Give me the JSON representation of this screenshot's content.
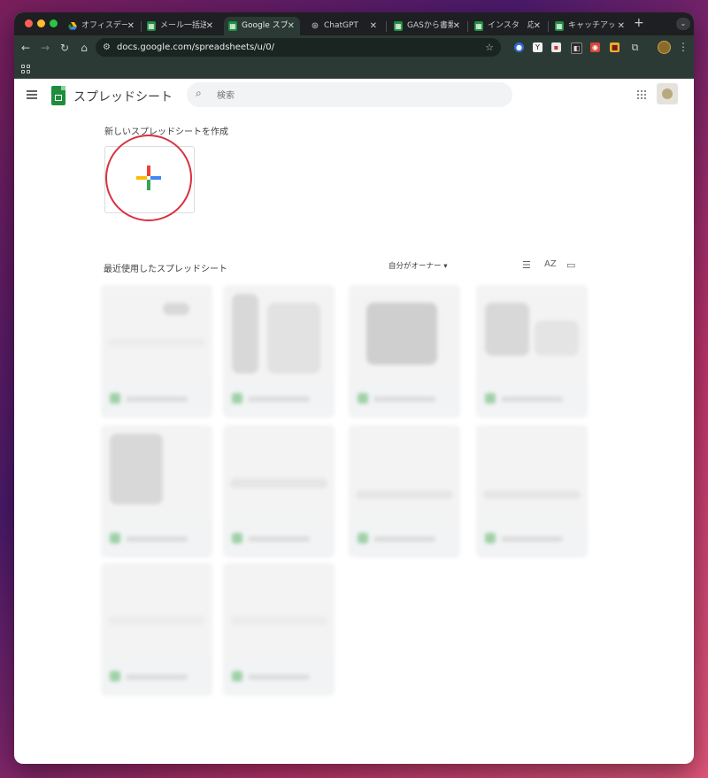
{
  "browser": {
    "tabs": [
      {
        "title": "オフィスデータ",
        "icon": "drive-icon",
        "active": false
      },
      {
        "title": "メール一括送信",
        "icon": "sheets-icon",
        "active": false
      },
      {
        "title": "Google スプレ",
        "icon": "sheets-icon",
        "active": true
      },
      {
        "title": "ChatGPT",
        "icon": "chatgpt-icon",
        "active": false
      },
      {
        "title": "GASから書類作",
        "icon": "sheets-icon",
        "active": false
      },
      {
        "title": "インスタ　応援",
        "icon": "sheets-icon",
        "active": false
      },
      {
        "title": "キャッチアップ",
        "icon": "sheets-icon",
        "active": false
      }
    ],
    "new_tab_label": "+",
    "url": "docs.google.com/spreadsheets/u/0/"
  },
  "header": {
    "app_title": "スプレッドシート",
    "search_placeholder": "検索"
  },
  "templates": {
    "section_label": "新しいスプレッドシートを作成"
  },
  "recent": {
    "section_label": "最近使用したスプレッドシート",
    "owner_filter": "自分がオーナー ▾"
  },
  "colors": {
    "plus_red": "#ea4335",
    "plus_blue": "#4285f4",
    "plus_yellow": "#fbbc04",
    "plus_green": "#34a853",
    "highlight_circle": "#d93040",
    "sheets_green": "#1e8e3e"
  }
}
